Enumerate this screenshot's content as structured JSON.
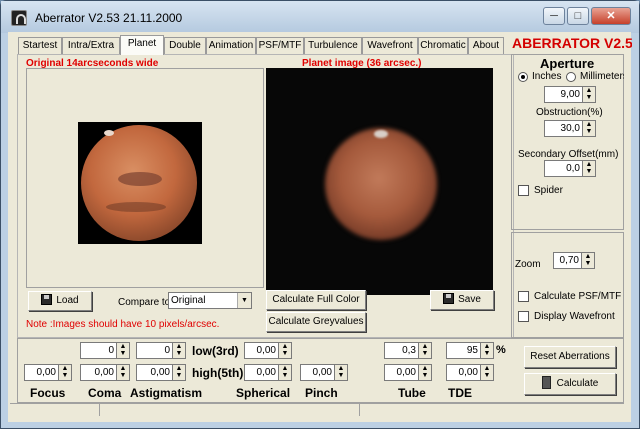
{
  "window": {
    "title": "Aberrator V2.53 21.11.2000",
    "minimize": "─",
    "maximize": "□",
    "close": "✕"
  },
  "tabs": [
    "Startest",
    "Intra/Extra",
    "Planet",
    "Double",
    "Animation",
    "PSF/MTF",
    "Turbulence",
    "Wavefront",
    "Chromatic",
    "About"
  ],
  "active_tab": "Planet",
  "brand": "ABERRATOR V2.5",
  "left": {
    "original_label": "Original  14arcseconds wide",
    "planet_label": "Planet image (36 arcsec.)",
    "load_button": "Load",
    "compare_label": "Compare to",
    "compare_value": "Original",
    "calc_full_color": "Calculate Full Color",
    "calc_grey": "Calculate Greyvalues",
    "save_button": "Save",
    "note": "Note :Images should have 10 pixels/arcsec."
  },
  "aperture": {
    "title": "Aperture",
    "inches_label": "Inches",
    "mm_label": "Millimeters",
    "unit_selected": "Inches",
    "diameter": "9,00",
    "obstruction_label": "Obstruction(%)",
    "obstruction": "30,0",
    "offset_label": "Secondary Offset(mm)",
    "offset": "0,0",
    "spider_label": "Spider"
  },
  "zoom": {
    "label": "Zoom",
    "value": "0,70"
  },
  "options": {
    "calc_psf": "Calculate PSF/MTF",
    "display_wavefront": "Display Wavefront"
  },
  "actions": {
    "reset": "Reset Aberrations",
    "calculate": "Calculate"
  },
  "aberrations": {
    "low_label": "low(3rd)",
    "high_label": "high(5th)",
    "pct": "%",
    "focus_label": "Focus",
    "coma_label": "Coma",
    "astig_label": "Astigmatism",
    "spherical_label": "Spherical",
    "pinch_label": "Pinch",
    "tube_label": "Tube",
    "tde_label": "TDE",
    "coma_low": "0",
    "astig_low": "0",
    "spherical_low": "0,00",
    "tube_top": "0,3",
    "tde_top": "95",
    "focus": "0,00",
    "coma_high": "0,00",
    "astig_high": "0,00",
    "spherical_high": "0,00",
    "pinch": "0,00",
    "tube": "0,00",
    "tde": "0,00"
  }
}
